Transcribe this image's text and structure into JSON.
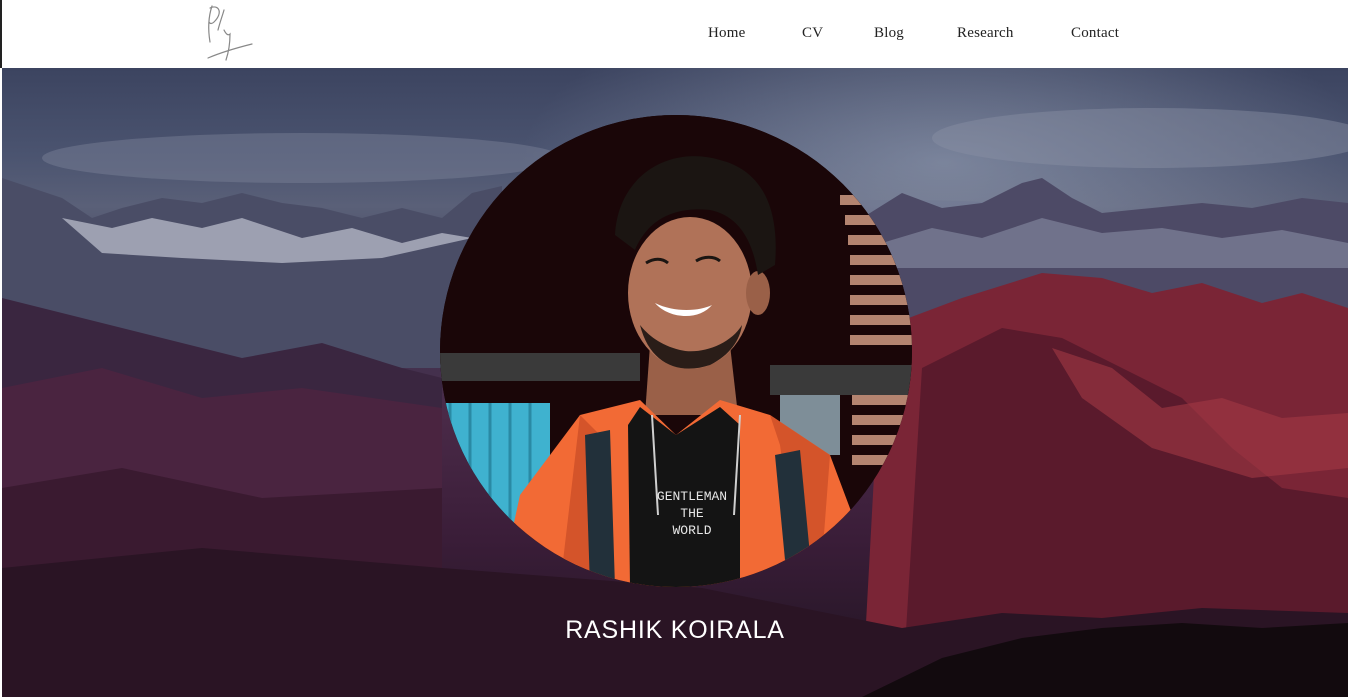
{
  "header": {
    "logo_icon": "signature-logo-icon",
    "nav": [
      {
        "label": "Home"
      },
      {
        "label": "CV"
      },
      {
        "label": "Blog"
      },
      {
        "label": "Research"
      },
      {
        "label": "Contact"
      }
    ]
  },
  "hero": {
    "background_image": "mountain-range-at-dusk",
    "portrait_image": "smiling-man-in-orange-jacket",
    "name": "RASHIK KOIRALA",
    "shirt_text": [
      "GENTLEMAN",
      "THE",
      "WORLD"
    ]
  },
  "colors": {
    "header_bg": "#ffffff",
    "nav_text": "#222222",
    "hero_text": "#ffffff",
    "jacket": "#f26a35",
    "mountain_red": "#8a2a3a"
  }
}
